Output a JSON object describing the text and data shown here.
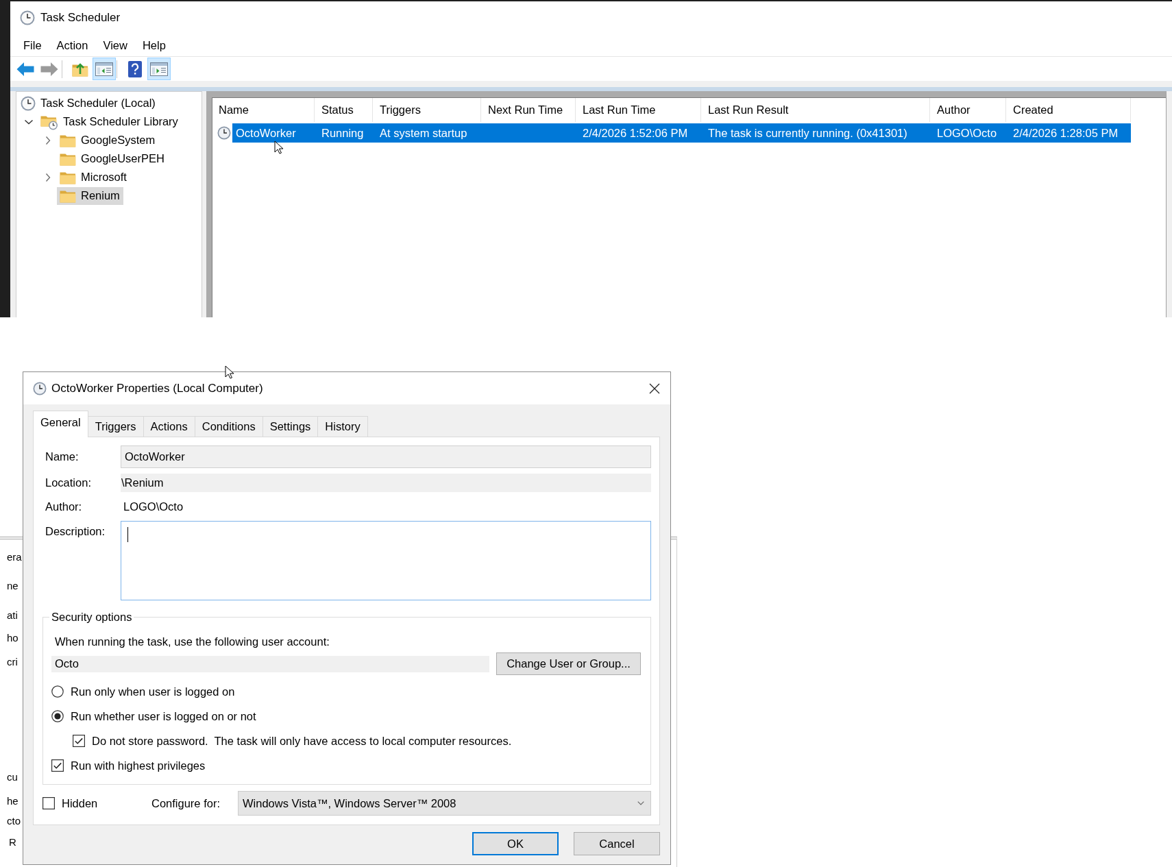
{
  "main_window": {
    "title": "Task Scheduler",
    "menu": [
      "File",
      "Action",
      "View",
      "Help"
    ],
    "toolbar": [
      {
        "kind": "back",
        "on": false,
        "disabled": false
      },
      {
        "kind": "forward",
        "on": false,
        "disabled": true
      },
      {
        "kind": "up",
        "on": false,
        "disabled": false
      },
      {
        "kind": "tree",
        "on": true,
        "disabled": false
      },
      {
        "kind": "help",
        "on": false,
        "disabled": false
      },
      {
        "kind": "pane",
        "on": true,
        "disabled": false
      }
    ],
    "tree": [
      {
        "label": "Task Scheduler (Local)",
        "kind": "root",
        "selected": false,
        "children": [
          {
            "label": "Task Scheduler Library",
            "kind": "library",
            "expandable": true,
            "expanded": true,
            "selected": false,
            "children": [
              {
                "label": "GoogleSystem",
                "kind": "folder",
                "expandable": true,
                "expanded": false,
                "selected": false
              },
              {
                "label": "GoogleUserPEH",
                "kind": "folder",
                "expandable": false,
                "selected": false
              },
              {
                "label": "Microsoft",
                "kind": "folder",
                "expandable": true,
                "expanded": false,
                "selected": false
              },
              {
                "label": "Renium",
                "kind": "folder",
                "expandable": false,
                "selected": true
              }
            ]
          }
        ]
      }
    ],
    "task_list": {
      "columns": [
        "Name",
        "Status",
        "Triggers",
        "Next Run Time",
        "Last Run Time",
        "Last Run Result",
        "Author",
        "Created"
      ],
      "rows": [
        {
          "selected": true,
          "cells": [
            "OctoWorker",
            "Running",
            "At system startup",
            null,
            "2/4/2026 1:52:06 PM",
            "The task is currently running. (0x41301)",
            "LOGO\\Octo",
            "2/4/2026 1:28:05 PM"
          ]
        }
      ]
    }
  },
  "background_window": {
    "fragments": [
      "era",
      "ne",
      "ati",
      "ho",
      "cri",
      "cu",
      "he",
      "cto",
      "R"
    ]
  },
  "dialog": {
    "title": "OctoWorker Properties (Local Computer)",
    "tabs": [
      {
        "label": "General",
        "selected": true
      },
      {
        "label": "Triggers",
        "selected": false
      },
      {
        "label": "Actions",
        "selected": false
      },
      {
        "label": "Conditions",
        "selected": false
      },
      {
        "label": "Settings",
        "selected": false
      },
      {
        "label": "History",
        "selected": false
      }
    ],
    "general": {
      "name": {
        "label": "Name:",
        "value": "OctoWorker"
      },
      "location": {
        "label": "Location:",
        "value": "\\Renium"
      },
      "author": {
        "label": "Author:",
        "value": "LOGO\\Octo"
      },
      "description": {
        "label": "Description:",
        "focused": true
      },
      "security": {
        "title": "Security options",
        "prompt": "When running the task, use the following user account:",
        "account": "Octo",
        "change_button": "Change User or Group...",
        "options": [
          {
            "kind": "radio",
            "label": "Run only when user is logged on",
            "selected": false
          },
          {
            "kind": "radio",
            "label": "Run whether user is logged on or not",
            "selected": true,
            "children": [
              {
                "kind": "checkbox",
                "label": "Do not store password.  The task will only have access to local computer resources.",
                "checked": true
              }
            ]
          },
          {
            "kind": "checkbox",
            "label": "Run with highest privileges",
            "checked": true
          }
        ]
      },
      "hidden": {
        "label": "Hidden",
        "checked": false
      },
      "configure_for": {
        "label": "Configure for:",
        "value": "Windows Vista™, Windows Server™ 2008"
      }
    },
    "buttons": [
      {
        "label": "OK",
        "default": true
      },
      {
        "label": "Cancel",
        "default": false
      }
    ]
  }
}
